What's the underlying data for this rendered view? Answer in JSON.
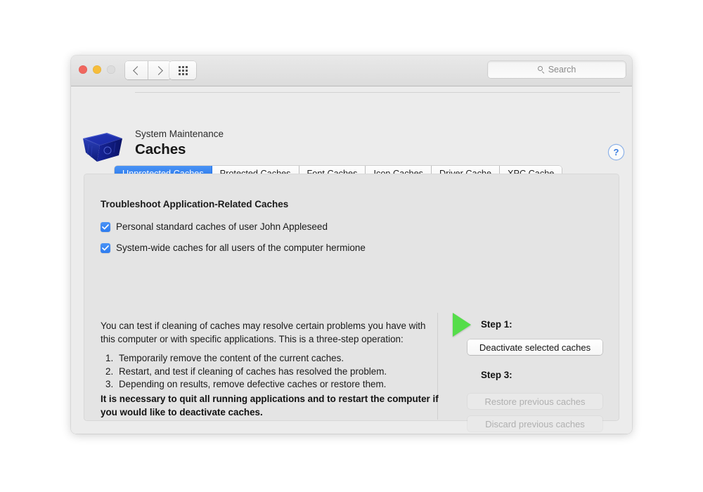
{
  "window": {
    "traffic_lights": [
      "close",
      "minimize",
      "zoom"
    ],
    "nav": {
      "back_label": "Back",
      "forward_label": "Forward"
    },
    "grid_button_label": "Show All",
    "search": {
      "placeholder": "Search",
      "value": ""
    }
  },
  "header": {
    "category": "System Maintenance",
    "title": "Caches",
    "help_label": "?",
    "icon_name": "blue-recycling-bin-icon"
  },
  "tabs": [
    {
      "label": "Unprotected Caches",
      "active": true
    },
    {
      "label": "Protected Caches",
      "active": false
    },
    {
      "label": "Font Caches",
      "active": false
    },
    {
      "label": "Icon Caches",
      "active": false
    },
    {
      "label": "Driver Cache",
      "active": false
    },
    {
      "label": "XPC Cache",
      "active": false
    }
  ],
  "content": {
    "section_title": "Troubleshoot Application-Related Caches",
    "checkboxes": [
      {
        "label": "Personal standard caches of user John Appleseed",
        "checked": true
      },
      {
        "label": "System-wide caches for all users of the computer hermione",
        "checked": true
      }
    ],
    "intro": "You can test if cleaning of caches may resolve certain problems you have with this computer or with specific applications. This is a three-step operation:",
    "steps": [
      {
        "num": "1.",
        "text": "Temporarily remove the content of the current caches."
      },
      {
        "num": "2.",
        "text": "Restart, and test if cleaning of caches has resolved the problem."
      },
      {
        "num": "3.",
        "text": "Depending on results, remove defective caches or restore them."
      }
    ],
    "warning": "It is necessary to quit all running applications and to restart the computer if you would like to deactivate caches."
  },
  "actions": {
    "step1_label": "Step 1:",
    "step3_label": "Step 3:",
    "deactivate_button": "Deactivate selected caches",
    "restore_button": "Restore previous caches",
    "discard_button": "Discard previous caches"
  },
  "colors": {
    "accent_blue": "#2d7bef",
    "arrow_green": "#55dd4a",
    "window_bg": "#ececec",
    "panel_bg": "#e4e4e4"
  }
}
